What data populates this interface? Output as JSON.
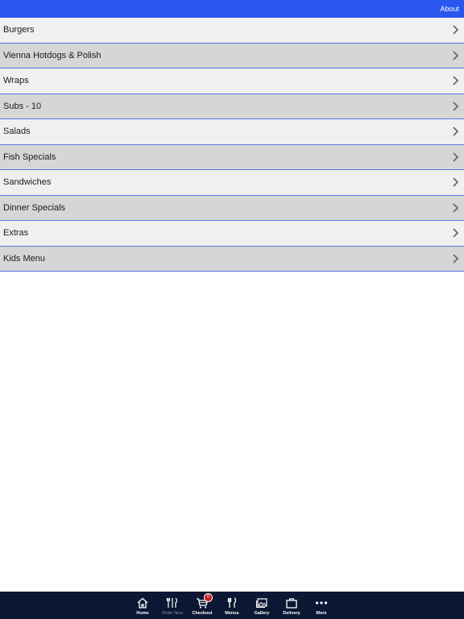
{
  "header": {
    "about_label": "About",
    "background": "#2a56ee"
  },
  "menu": {
    "items": [
      {
        "label": "Burgers"
      },
      {
        "label": "Vienna Hotdogs & Polish"
      },
      {
        "label": "Wraps"
      },
      {
        "label": "Subs - 10"
      },
      {
        "label": "Salads"
      },
      {
        "label": "Fish Specials"
      },
      {
        "label": "Sandwiches"
      },
      {
        "label": "Dinner Specials"
      },
      {
        "label": "Extras"
      },
      {
        "label": "Kids Menu"
      }
    ],
    "chevron_icon": "chevron-right-icon"
  },
  "tabbar": {
    "background": "#0c1733",
    "tabs": [
      {
        "label": "Home",
        "icon": "home-icon"
      },
      {
        "label": "Order Now",
        "icon": "utensils-icon"
      },
      {
        "label": "Checkout",
        "icon": "cart-icon",
        "badge": "0"
      },
      {
        "label": "Menus",
        "icon": "fork-knife-icon"
      },
      {
        "label": "Gallery",
        "icon": "gallery-icon"
      },
      {
        "label": "Delivery",
        "icon": "bag-icon"
      },
      {
        "label": "More",
        "icon": "more-icon"
      }
    ]
  }
}
